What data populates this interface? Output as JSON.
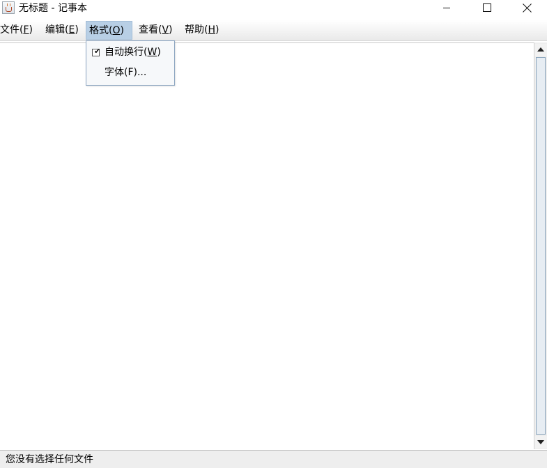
{
  "window": {
    "title": "无标题 - 记事本",
    "icon": "java-cup-icon"
  },
  "menubar": {
    "items": [
      {
        "name": "文件(",
        "key": "F",
        "end": ")"
      },
      {
        "name": "编辑(",
        "key": "E",
        "end": ")"
      },
      {
        "name": "格式(",
        "key": "O",
        "end": ")"
      },
      {
        "name": "查看(",
        "key": "V",
        "end": ")"
      },
      {
        "name": "帮助(",
        "key": "H",
        "end": ")"
      }
    ],
    "active_index": 2
  },
  "format_menu": {
    "items": [
      {
        "name": "自动换行(",
        "key": "W",
        "end": ")",
        "checked": true
      },
      {
        "name": "字体(F)...",
        "checked": false
      }
    ]
  },
  "editor": {
    "content": ""
  },
  "status": {
    "text": "您没有选择任何文件"
  },
  "colors": {
    "menu_highlight": "#b8cfe5",
    "dropdown_border": "#8aa4c0",
    "scroll_track_border": "#8ba5bd"
  }
}
